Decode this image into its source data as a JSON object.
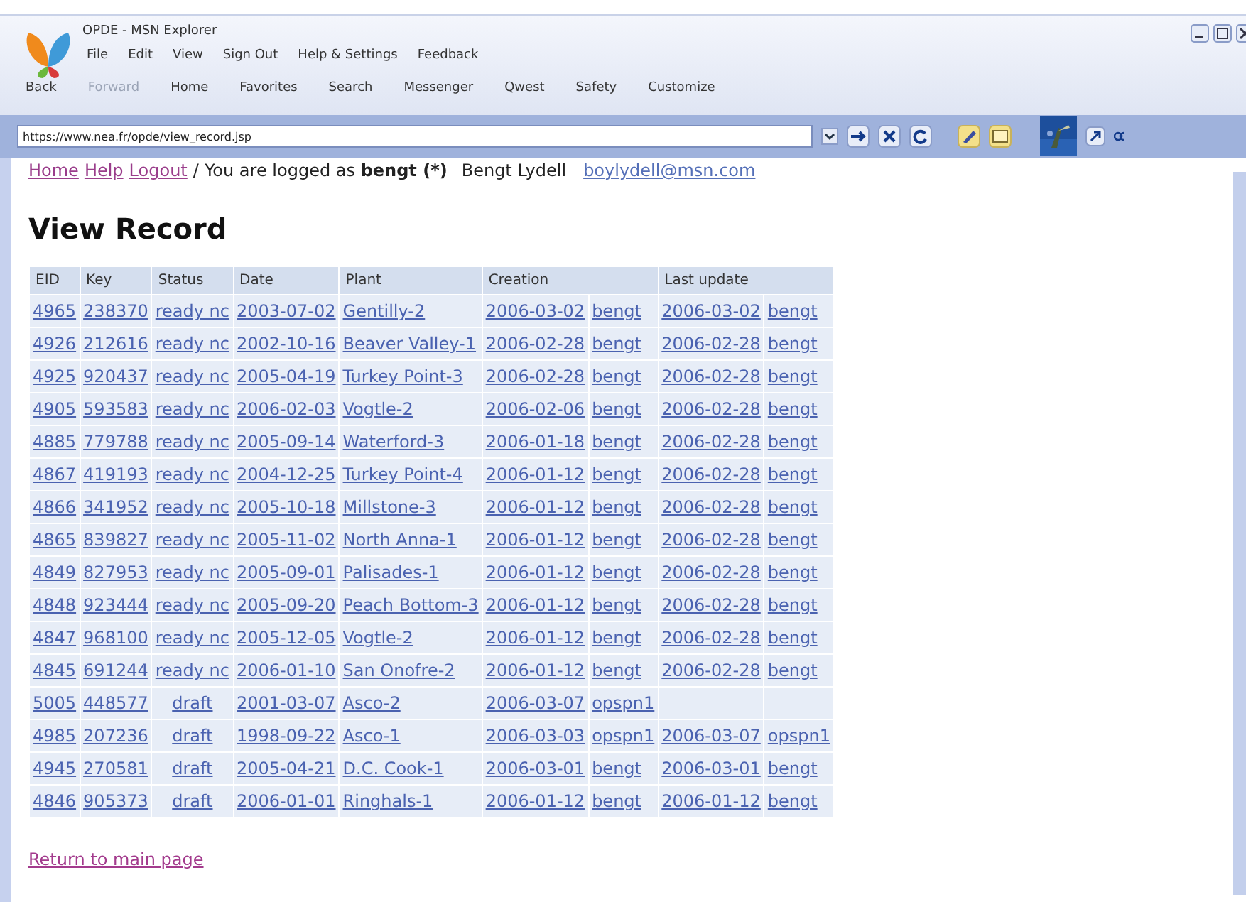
{
  "window": {
    "title": "OPDE - MSN Explorer"
  },
  "menu": [
    "File",
    "Edit",
    "View",
    "Sign Out",
    "Help & Settings",
    "Feedback"
  ],
  "nav": [
    {
      "label": "Back",
      "disabled": false
    },
    {
      "label": "Forward",
      "disabled": true
    },
    {
      "label": "Home",
      "disabled": false
    },
    {
      "label": "Favorites",
      "disabled": false
    },
    {
      "label": "Search",
      "disabled": false
    },
    {
      "label": "Messenger",
      "disabled": false
    },
    {
      "label": "Qwest",
      "disabled": false
    },
    {
      "label": "Safety",
      "disabled": false
    },
    {
      "label": "Customize",
      "disabled": false
    }
  ],
  "address": {
    "value": "https://www.nea.fr/opde/view_record.jsp"
  },
  "user_bar": {
    "links": [
      "Home",
      "Help",
      "Logout"
    ],
    "separator": "/",
    "text": "You are logged as **bengt (*)**",
    "name": "Bengt Lydell",
    "email": "boylydell@msn.com"
  },
  "heading": "View Record",
  "table": {
    "columns": [
      "EID",
      "Key",
      "Status",
      "Date",
      "Plant",
      "Creation",
      "Last update"
    ],
    "rows": [
      {
        "eid": "4965",
        "key": "238370",
        "status": "ready nc",
        "date": "2003-07-02",
        "plant": "Gentilly-2",
        "created": "2006-03-02",
        "created_by": "bengt",
        "updated": "2006-03-02",
        "updated_by": "bengt"
      },
      {
        "eid": "4926",
        "key": "212616",
        "status": "ready nc",
        "date": "2002-10-16",
        "plant": "Beaver Valley-1",
        "created": "2006-02-28",
        "created_by": "bengt",
        "updated": "2006-02-28",
        "updated_by": "bengt"
      },
      {
        "eid": "4925",
        "key": "920437",
        "status": "ready nc",
        "date": "2005-04-19",
        "plant": "Turkey Point-3",
        "created": "2006-02-28",
        "created_by": "bengt",
        "updated": "2006-02-28",
        "updated_by": "bengt"
      },
      {
        "eid": "4905",
        "key": "593583",
        "status": "ready nc",
        "date": "2006-02-03",
        "plant": "Vogtle-2",
        "created": "2006-02-06",
        "created_by": "bengt",
        "updated": "2006-02-28",
        "updated_by": "bengt"
      },
      {
        "eid": "4885",
        "key": "779788",
        "status": "ready nc",
        "date": "2005-09-14",
        "plant": "Waterford-3",
        "created": "2006-01-18",
        "created_by": "bengt",
        "updated": "2006-02-28",
        "updated_by": "bengt"
      },
      {
        "eid": "4867",
        "key": "419193",
        "status": "ready nc",
        "date": "2004-12-25",
        "plant": "Turkey Point-4",
        "created": "2006-01-12",
        "created_by": "bengt",
        "updated": "2006-02-28",
        "updated_by": "bengt"
      },
      {
        "eid": "4866",
        "key": "341952",
        "status": "ready nc",
        "date": "2005-10-18",
        "plant": "Millstone-3",
        "created": "2006-01-12",
        "created_by": "bengt",
        "updated": "2006-02-28",
        "updated_by": "bengt"
      },
      {
        "eid": "4865",
        "key": "839827",
        "status": "ready nc",
        "date": "2005-11-02",
        "plant": "North Anna-1",
        "created": "2006-01-12",
        "created_by": "bengt",
        "updated": "2006-02-28",
        "updated_by": "bengt"
      },
      {
        "eid": "4849",
        "key": "827953",
        "status": "ready nc",
        "date": "2005-09-01",
        "plant": "Palisades-1",
        "created": "2006-01-12",
        "created_by": "bengt",
        "updated": "2006-02-28",
        "updated_by": "bengt"
      },
      {
        "eid": "4848",
        "key": "923444",
        "status": "ready nc",
        "date": "2005-09-20",
        "plant": "Peach Bottom-3",
        "created": "2006-01-12",
        "created_by": "bengt",
        "updated": "2006-02-28",
        "updated_by": "bengt"
      },
      {
        "eid": "4847",
        "key": "968100",
        "status": "ready nc",
        "date": "2005-12-05",
        "plant": "Vogtle-2",
        "created": "2006-01-12",
        "created_by": "bengt",
        "updated": "2006-02-28",
        "updated_by": "bengt"
      },
      {
        "eid": "4845",
        "key": "691244",
        "status": "ready nc",
        "date": "2006-01-10",
        "plant": "San Onofre-2",
        "created": "2006-01-12",
        "created_by": "bengt",
        "updated": "2006-02-28",
        "updated_by": "bengt"
      },
      {
        "eid": "5005",
        "key": "448577",
        "status": "draft",
        "date": "2001-03-07",
        "plant": "Asco-2",
        "created": "2006-03-07",
        "created_by": "opspn1"
      },
      {
        "eid": "4985",
        "key": "207236",
        "status": "draft",
        "date": "1998-09-22",
        "plant": "Asco-1",
        "created": "2006-03-03",
        "created_by": "opspn1",
        "updated": "2006-03-07",
        "updated_by": "opspn1"
      },
      {
        "eid": "4945",
        "key": "270581",
        "status": "draft",
        "date": "2005-04-21",
        "plant": "D.C. Cook-1",
        "created": "2006-03-01",
        "created_by": "bengt",
        "updated": "2006-03-01",
        "updated_by": "bengt"
      },
      {
        "eid": "4846",
        "key": "905373",
        "status": "draft",
        "date": "2006-01-01",
        "plant": "Ringhals-1",
        "created": "2006-01-12",
        "created_by": "bengt",
        "updated": "2006-01-12",
        "updated_by": "bengt"
      }
    ]
  },
  "footer_link": "Return to main page"
}
